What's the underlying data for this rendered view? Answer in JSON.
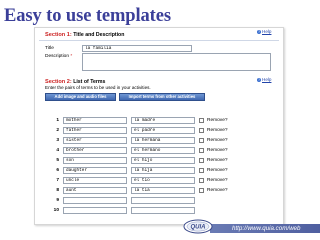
{
  "slide_title": "Easy to use templates",
  "section1": {
    "number": "Section 1:",
    "name": "Title and Description",
    "help": "Help"
  },
  "title_field": {
    "label": "Title",
    "value": "la familia"
  },
  "description_field": {
    "label": "Description",
    "required_mark": "*"
  },
  "section2": {
    "number": "Section 2:",
    "name": "List of Terms",
    "help": "Help"
  },
  "instructions": "Enter the pairs of terms to be used in your activities.",
  "buttons": {
    "add_image": "Add image and audio files",
    "import_terms": "Import terms from other activities"
  },
  "remove_label": "Remove?",
  "rows": [
    {
      "n": "1",
      "term": "mother",
      "def": "la madre"
    },
    {
      "n": "2",
      "term": "father",
      "def": "el padre"
    },
    {
      "n": "3",
      "term": "sister",
      "def": "la hermana"
    },
    {
      "n": "4",
      "term": "brother",
      "def": "el hermano"
    },
    {
      "n": "5",
      "term": "son",
      "def": "el hijo"
    },
    {
      "n": "6",
      "term": "daughter",
      "def": "la hija"
    },
    {
      "n": "7",
      "term": "uncle",
      "def": "el tio"
    },
    {
      "n": "8",
      "term": "aunt",
      "def": "la tia"
    },
    {
      "n": "9",
      "term": "",
      "def": ""
    },
    {
      "n": "10",
      "term": "",
      "def": ""
    }
  ],
  "logo_text": "QUIA",
  "footer_url": "http://www.quia.com/web",
  "colors": {
    "title": "#3b3f99",
    "section_number": "#cc2222",
    "button": "#3f67b0",
    "footer_bar": "#5a6aa8"
  }
}
